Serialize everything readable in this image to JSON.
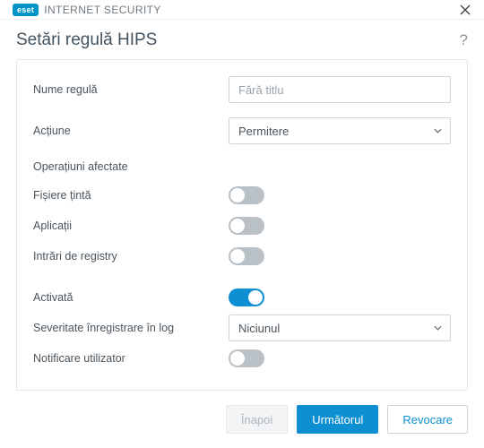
{
  "brand": {
    "badge": "eset",
    "name": "INTERNET SECURITY"
  },
  "page": {
    "title": "Setări regulă HIPS"
  },
  "fields": {
    "rule_name": {
      "label": "Nume regulă",
      "placeholder": "Fără titlu",
      "value": ""
    },
    "action": {
      "label": "Acțiune",
      "selected": "Permitere"
    },
    "affected_ops_heading": "Operațiuni afectate",
    "target_files": {
      "label": "Fișiere țintă",
      "on": false
    },
    "applications": {
      "label": "Aplicații",
      "on": false
    },
    "registry_entries": {
      "label": "Intrări de registry",
      "on": false
    },
    "enabled": {
      "label": "Activată",
      "on": true
    },
    "log_severity": {
      "label": "Severitate înregistrare în log",
      "selected": "Niciunul"
    },
    "notify_user": {
      "label": "Notificare utilizator",
      "on": false
    }
  },
  "footer": {
    "back": "Înapoi",
    "next": "Următorul",
    "cancel": "Revocare"
  }
}
